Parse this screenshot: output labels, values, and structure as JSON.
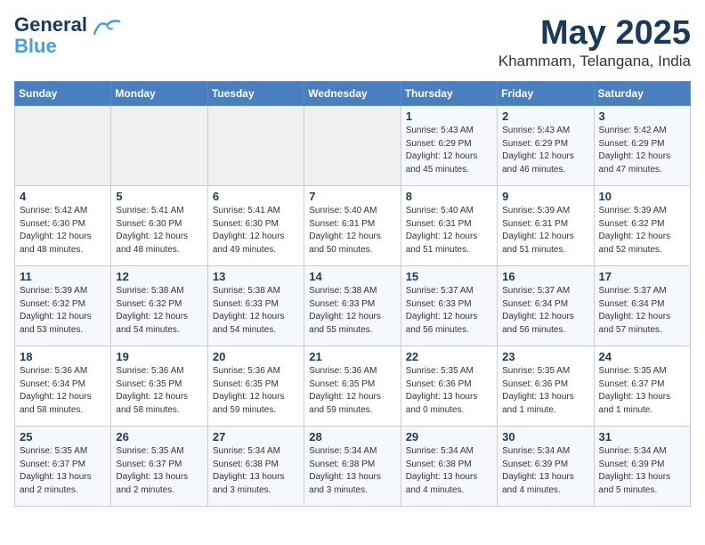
{
  "logo": {
    "line1": "General",
    "line2": "Blue"
  },
  "title": "May 2025",
  "location": "Khammam, Telangana, India",
  "days_of_week": [
    "Sunday",
    "Monday",
    "Tuesday",
    "Wednesday",
    "Thursday",
    "Friday",
    "Saturday"
  ],
  "weeks": [
    [
      {
        "day": "",
        "info": ""
      },
      {
        "day": "",
        "info": ""
      },
      {
        "day": "",
        "info": ""
      },
      {
        "day": "",
        "info": ""
      },
      {
        "day": "1",
        "info": "Sunrise: 5:43 AM\nSunset: 6:29 PM\nDaylight: 12 hours\nand 45 minutes."
      },
      {
        "day": "2",
        "info": "Sunrise: 5:43 AM\nSunset: 6:29 PM\nDaylight: 12 hours\nand 46 minutes."
      },
      {
        "day": "3",
        "info": "Sunrise: 5:42 AM\nSunset: 6:29 PM\nDaylight: 12 hours\nand 47 minutes."
      }
    ],
    [
      {
        "day": "4",
        "info": "Sunrise: 5:42 AM\nSunset: 6:30 PM\nDaylight: 12 hours\nand 48 minutes."
      },
      {
        "day": "5",
        "info": "Sunrise: 5:41 AM\nSunset: 6:30 PM\nDaylight: 12 hours\nand 48 minutes."
      },
      {
        "day": "6",
        "info": "Sunrise: 5:41 AM\nSunset: 6:30 PM\nDaylight: 12 hours\nand 49 minutes."
      },
      {
        "day": "7",
        "info": "Sunrise: 5:40 AM\nSunset: 6:31 PM\nDaylight: 12 hours\nand 50 minutes."
      },
      {
        "day": "8",
        "info": "Sunrise: 5:40 AM\nSunset: 6:31 PM\nDaylight: 12 hours\nand 51 minutes."
      },
      {
        "day": "9",
        "info": "Sunrise: 5:39 AM\nSunset: 6:31 PM\nDaylight: 12 hours\nand 51 minutes."
      },
      {
        "day": "10",
        "info": "Sunrise: 5:39 AM\nSunset: 6:32 PM\nDaylight: 12 hours\nand 52 minutes."
      }
    ],
    [
      {
        "day": "11",
        "info": "Sunrise: 5:39 AM\nSunset: 6:32 PM\nDaylight: 12 hours\nand 53 minutes."
      },
      {
        "day": "12",
        "info": "Sunrise: 5:38 AM\nSunset: 6:32 PM\nDaylight: 12 hours\nand 54 minutes."
      },
      {
        "day": "13",
        "info": "Sunrise: 5:38 AM\nSunset: 6:33 PM\nDaylight: 12 hours\nand 54 minutes."
      },
      {
        "day": "14",
        "info": "Sunrise: 5:38 AM\nSunset: 6:33 PM\nDaylight: 12 hours\nand 55 minutes."
      },
      {
        "day": "15",
        "info": "Sunrise: 5:37 AM\nSunset: 6:33 PM\nDaylight: 12 hours\nand 56 minutes."
      },
      {
        "day": "16",
        "info": "Sunrise: 5:37 AM\nSunset: 6:34 PM\nDaylight: 12 hours\nand 56 minutes."
      },
      {
        "day": "17",
        "info": "Sunrise: 5:37 AM\nSunset: 6:34 PM\nDaylight: 12 hours\nand 57 minutes."
      }
    ],
    [
      {
        "day": "18",
        "info": "Sunrise: 5:36 AM\nSunset: 6:34 PM\nDaylight: 12 hours\nand 58 minutes."
      },
      {
        "day": "19",
        "info": "Sunrise: 5:36 AM\nSunset: 6:35 PM\nDaylight: 12 hours\nand 58 minutes."
      },
      {
        "day": "20",
        "info": "Sunrise: 5:36 AM\nSunset: 6:35 PM\nDaylight: 12 hours\nand 59 minutes."
      },
      {
        "day": "21",
        "info": "Sunrise: 5:36 AM\nSunset: 6:35 PM\nDaylight: 12 hours\nand 59 minutes."
      },
      {
        "day": "22",
        "info": "Sunrise: 5:35 AM\nSunset: 6:36 PM\nDaylight: 13 hours\nand 0 minutes."
      },
      {
        "day": "23",
        "info": "Sunrise: 5:35 AM\nSunset: 6:36 PM\nDaylight: 13 hours\nand 1 minute."
      },
      {
        "day": "24",
        "info": "Sunrise: 5:35 AM\nSunset: 6:37 PM\nDaylight: 13 hours\nand 1 minute."
      }
    ],
    [
      {
        "day": "25",
        "info": "Sunrise: 5:35 AM\nSunset: 6:37 PM\nDaylight: 13 hours\nand 2 minutes."
      },
      {
        "day": "26",
        "info": "Sunrise: 5:35 AM\nSunset: 6:37 PM\nDaylight: 13 hours\nand 2 minutes."
      },
      {
        "day": "27",
        "info": "Sunrise: 5:34 AM\nSunset: 6:38 PM\nDaylight: 13 hours\nand 3 minutes."
      },
      {
        "day": "28",
        "info": "Sunrise: 5:34 AM\nSunset: 6:38 PM\nDaylight: 13 hours\nand 3 minutes."
      },
      {
        "day": "29",
        "info": "Sunrise: 5:34 AM\nSunset: 6:38 PM\nDaylight: 13 hours\nand 4 minutes."
      },
      {
        "day": "30",
        "info": "Sunrise: 5:34 AM\nSunset: 6:39 PM\nDaylight: 13 hours\nand 4 minutes."
      },
      {
        "day": "31",
        "info": "Sunrise: 5:34 AM\nSunset: 6:39 PM\nDaylight: 13 hours\nand 5 minutes."
      }
    ]
  ]
}
